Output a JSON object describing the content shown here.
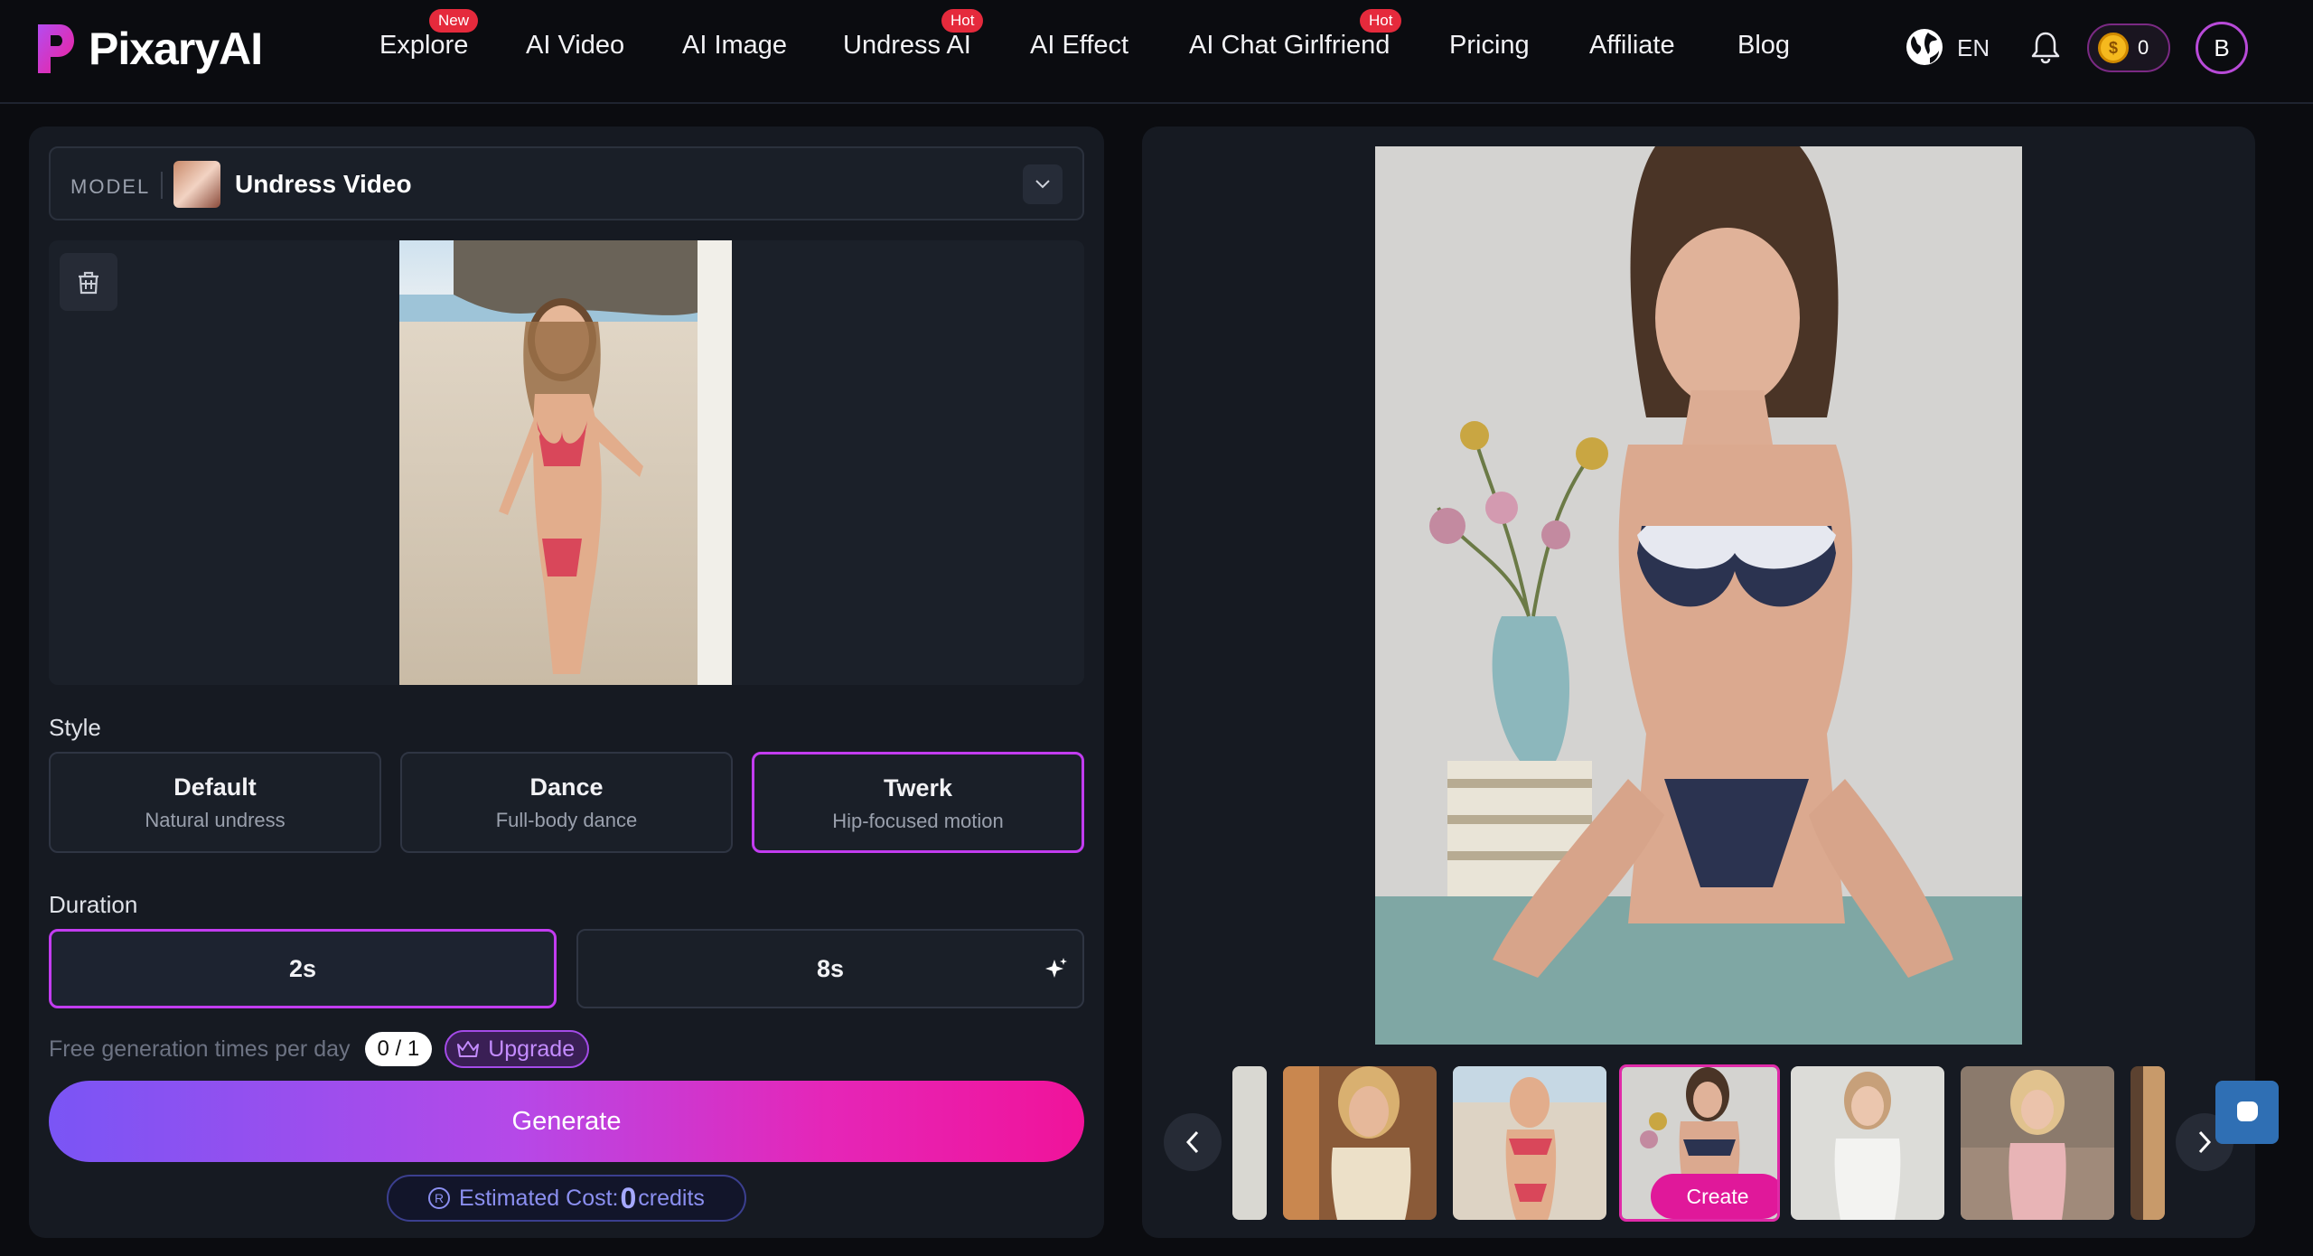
{
  "header": {
    "logo_text": "PixaryAI",
    "nav": [
      {
        "label": "Explore",
        "badge": "New"
      },
      {
        "label": "AI Video",
        "badge": ""
      },
      {
        "label": "AI Image",
        "badge": ""
      },
      {
        "label": "Undress AI",
        "badge": "Hot"
      },
      {
        "label": "AI Effect",
        "badge": ""
      },
      {
        "label": "AI Chat Girlfriend",
        "badge": "Hot"
      },
      {
        "label": "Pricing",
        "badge": ""
      },
      {
        "label": "Affiliate",
        "badge": ""
      },
      {
        "label": "Blog",
        "badge": ""
      }
    ],
    "language": "EN",
    "credits": "0",
    "avatar_initial": "B"
  },
  "model": {
    "label": "MODEL",
    "name": "Undress Video"
  },
  "style": {
    "label": "Style",
    "options": [
      {
        "title": "Default",
        "subtitle": "Natural undress"
      },
      {
        "title": "Dance",
        "subtitle": "Full-body dance"
      },
      {
        "title": "Twerk",
        "subtitle": "Hip-focused motion"
      }
    ],
    "selected": "Twerk"
  },
  "duration": {
    "label": "Duration",
    "options": [
      "2s",
      "8s"
    ],
    "selected": "2s"
  },
  "free": {
    "text": "Free generation times per day",
    "count": "0 / 1",
    "upgrade_label": "Upgrade"
  },
  "generate_label": "Generate",
  "cost": {
    "prefix": "Estimated Cost:",
    "amount": "0",
    "suffix": "credits"
  },
  "gallery": {
    "create_label": "Create"
  },
  "colors": {
    "accent": "#c23cf0",
    "badge_red": "#e52a3c",
    "generate_start": "#7a55f5",
    "generate_end": "#f0139a"
  }
}
